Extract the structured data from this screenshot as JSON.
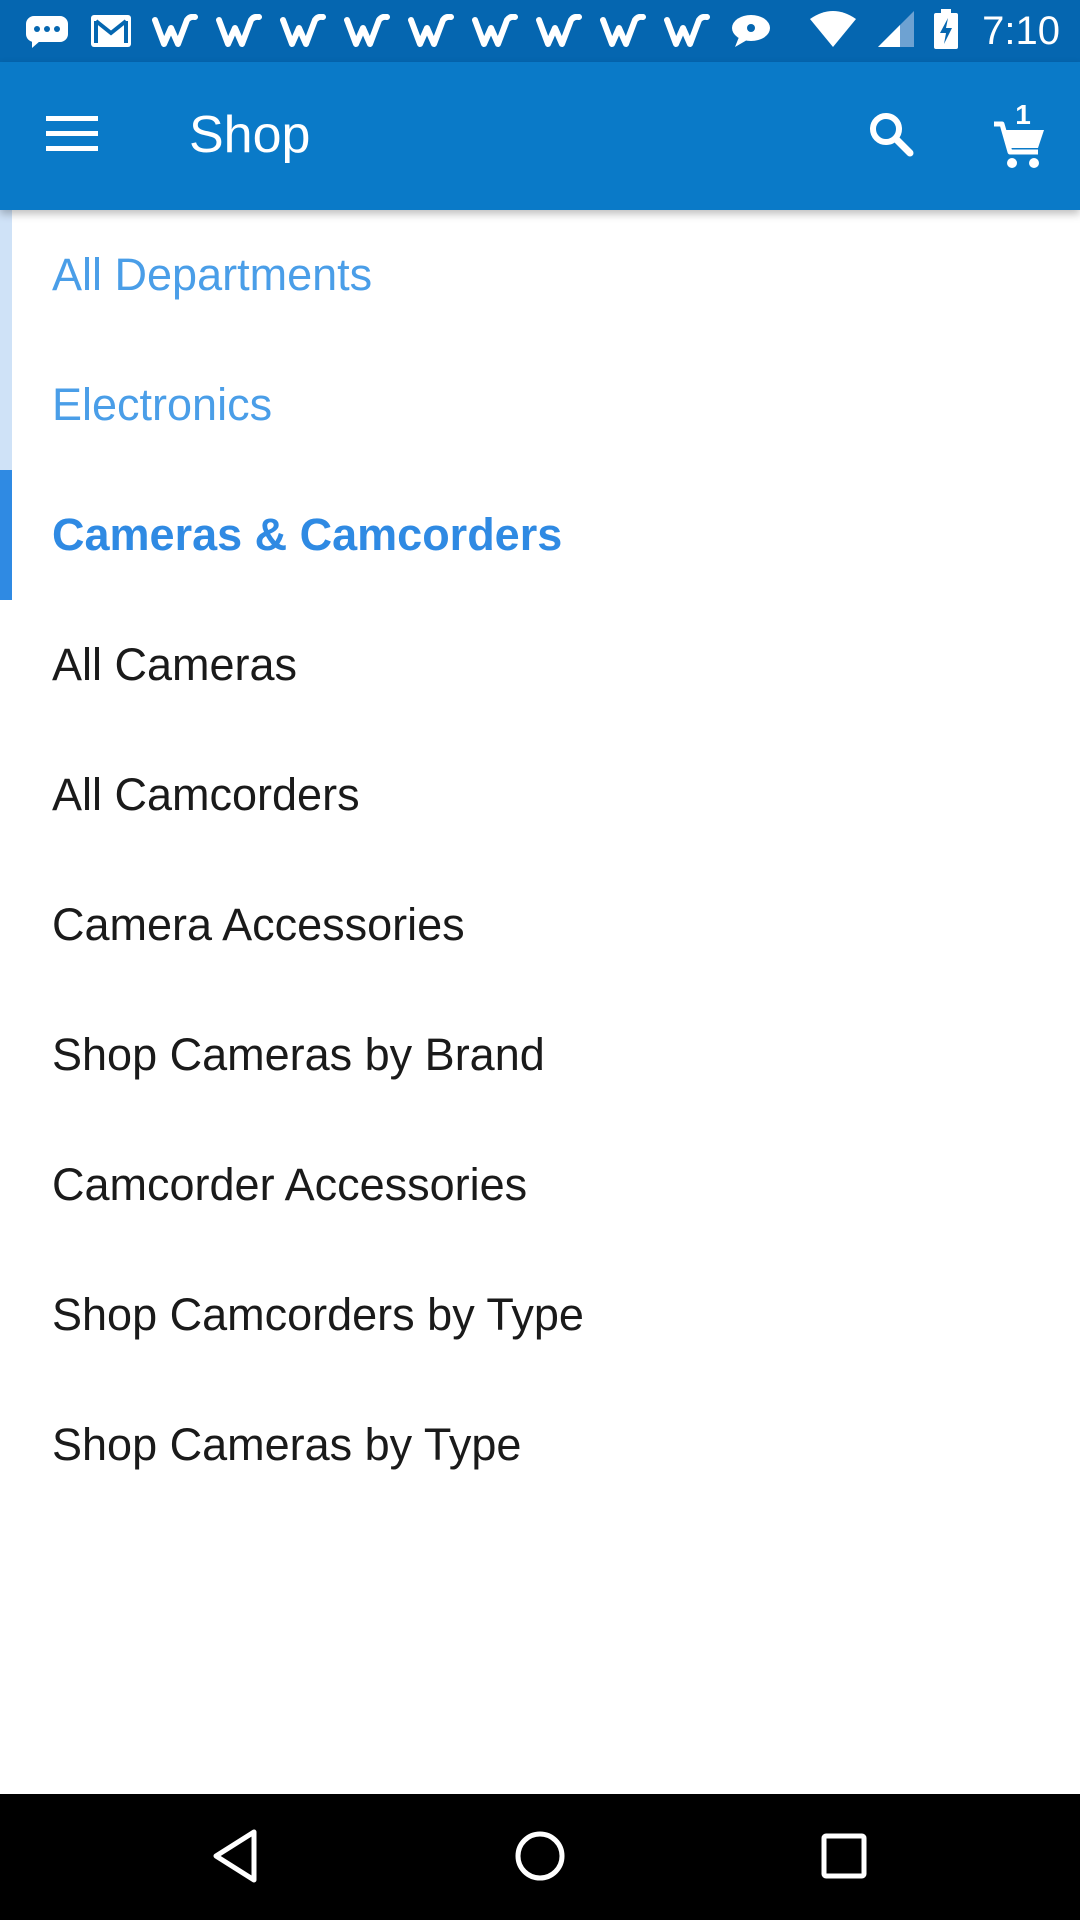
{
  "status_bar": {
    "notification_icons": [
      "chat-bubble-icon",
      "gmail-icon",
      "w-app-icon",
      "w-app-icon",
      "w-app-icon",
      "w-app-icon",
      "w-app-icon",
      "w-app-icon",
      "w-app-icon",
      "w-app-icon",
      "w-app-icon",
      "message-bubble-icon"
    ],
    "system_icons": [
      "wifi-icon",
      "cell-signal-icon",
      "battery-charging-icon"
    ],
    "time": "7:10"
  },
  "app_bar": {
    "title": "Shop",
    "cart_count": "1",
    "background_color": "#0a7ac8"
  },
  "categories": {
    "breadcrumbs": [
      {
        "label": "All Departments"
      },
      {
        "label": "Electronics"
      }
    ],
    "current": {
      "label": "Cameras & Camcorders"
    },
    "items": [
      {
        "label": "All Cameras"
      },
      {
        "label": "All Camcorders"
      },
      {
        "label": "Camera Accessories"
      },
      {
        "label": "Shop Cameras by Brand"
      },
      {
        "label": "Camcorder Accessories"
      },
      {
        "label": "Shop Camcorders by Type"
      },
      {
        "label": "Shop Cameras by Type"
      }
    ]
  },
  "nav_bar": {
    "buttons": [
      "back-icon",
      "home-icon",
      "recents-icon"
    ]
  },
  "colors": {
    "status_bar": "#0566b0",
    "accent": "#2f8ae3",
    "breadcrumb_text": "#4a9ee8"
  }
}
